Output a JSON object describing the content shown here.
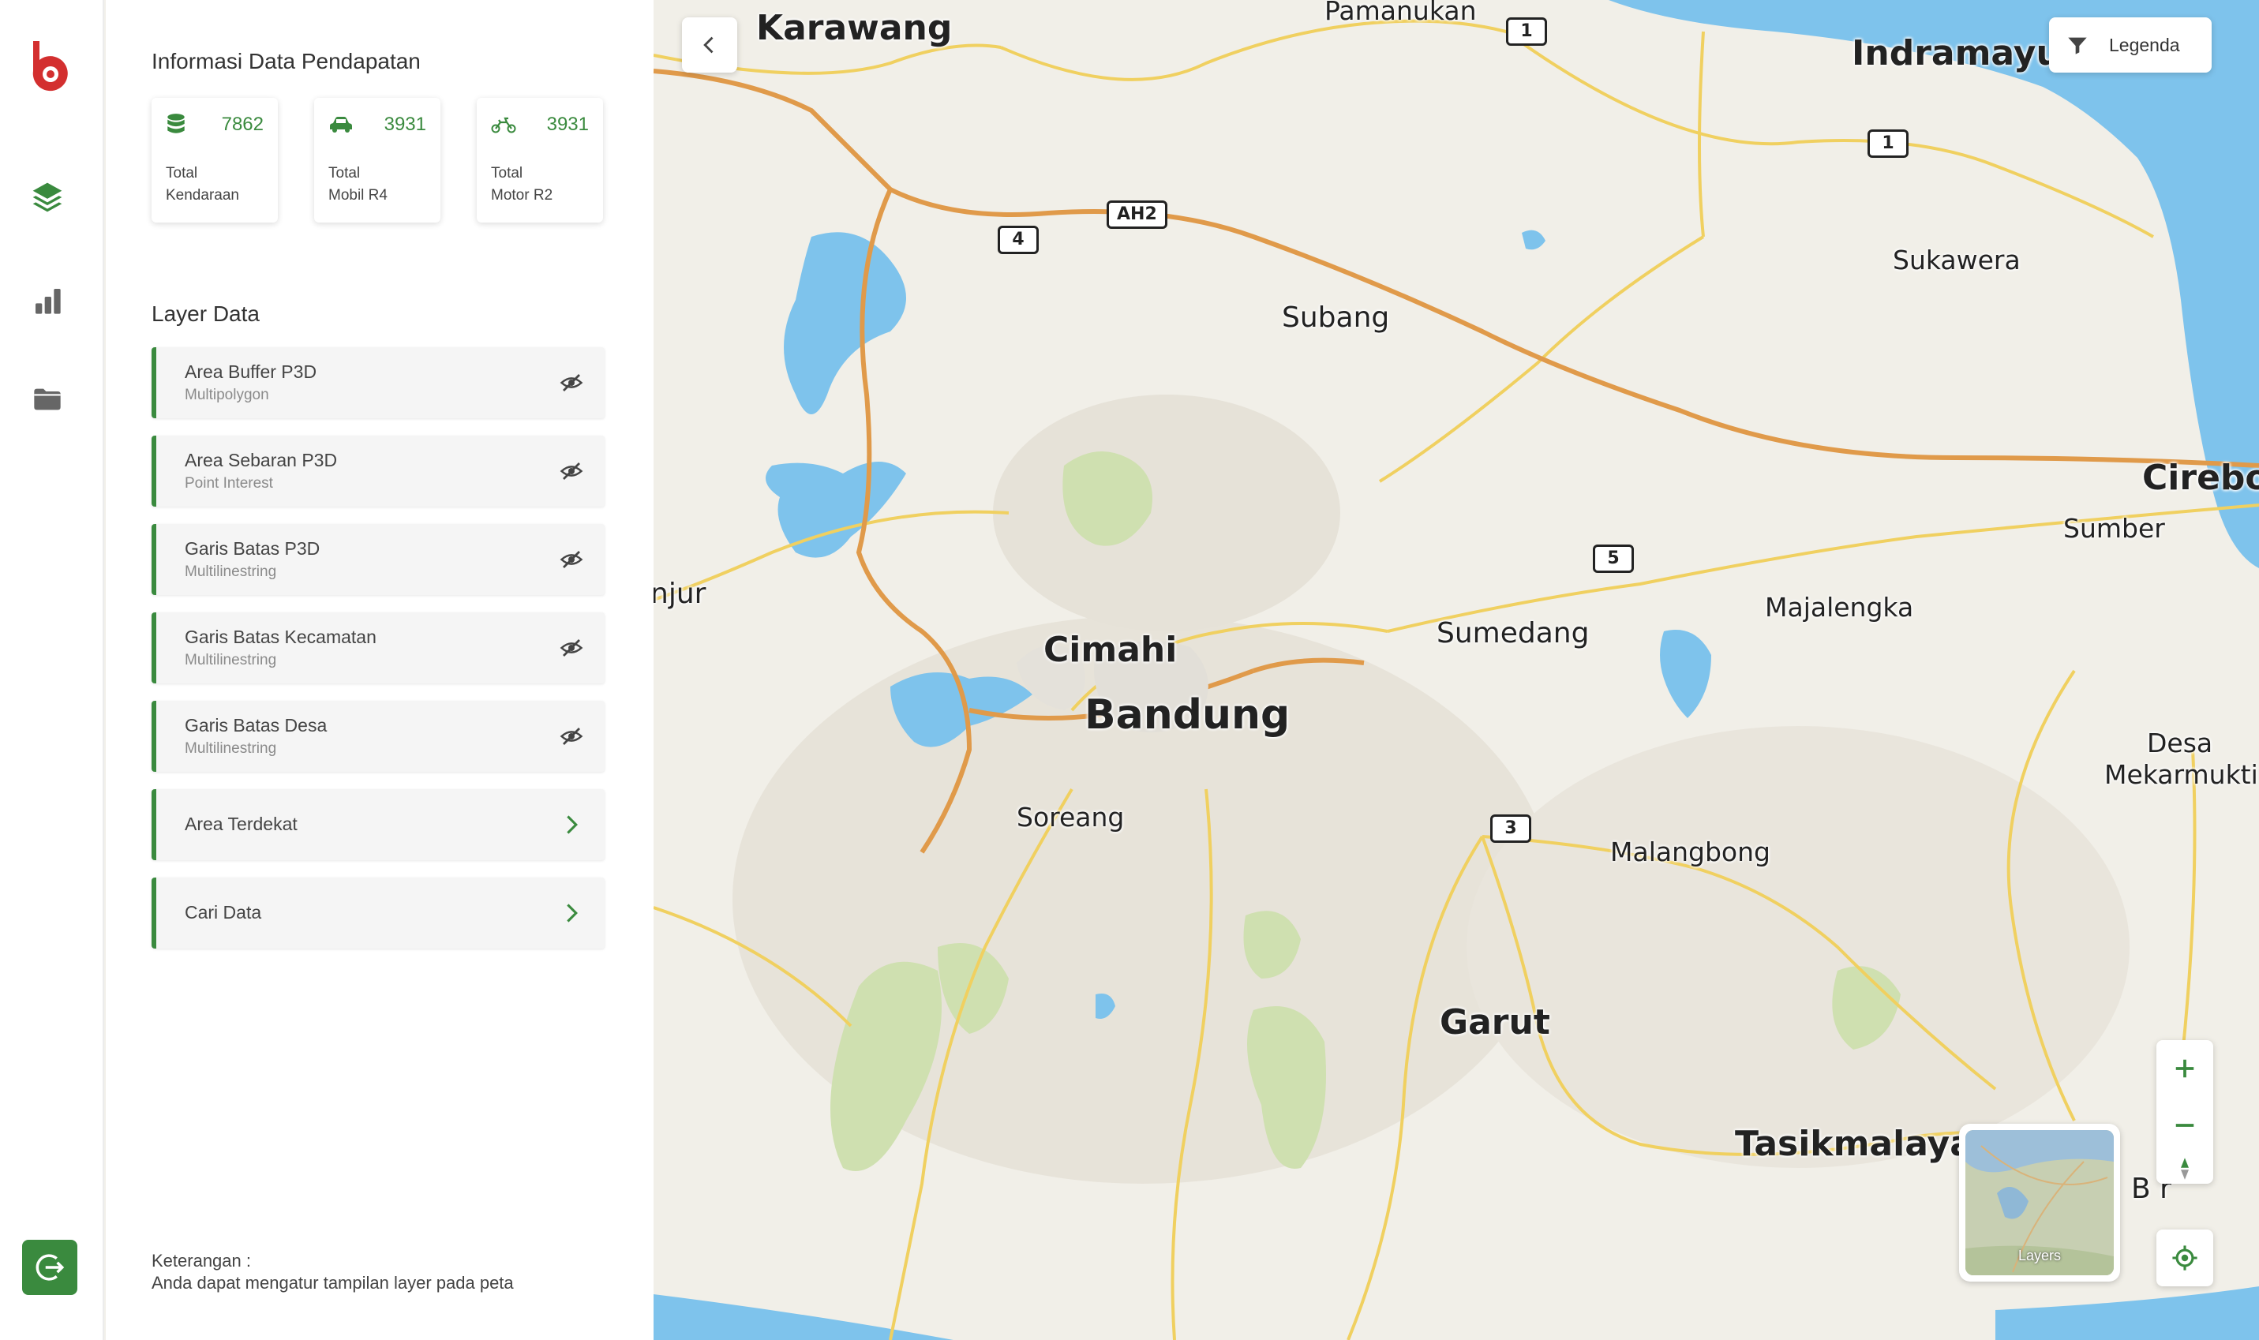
{
  "sidebar": {
    "nav": [
      {
        "icon": "layers-icon"
      },
      {
        "icon": "bar-chart-icon"
      },
      {
        "icon": "folder-icon"
      }
    ],
    "logout_icon": "logout-icon"
  },
  "info": {
    "title": "Informasi Data Pendapatan",
    "stats": [
      {
        "icon": "database-icon",
        "value": "7862",
        "label_line1": "Total",
        "label_line2": "Kendaraan"
      },
      {
        "icon": "car-icon",
        "value": "3931",
        "label_line1": "Total",
        "label_line2": "Mobil R4"
      },
      {
        "icon": "motorcycle-icon",
        "value": "3931",
        "label_line1": "Total",
        "label_line2": "Motor R2"
      }
    ]
  },
  "layers": {
    "title": "Layer Data",
    "items": [
      {
        "name": "Area Buffer P3D",
        "type": "Multipolygon",
        "action_icon": "eye-off-icon"
      },
      {
        "name": "Area Sebaran P3D",
        "type": "Point Interest",
        "action_icon": "eye-off-icon"
      },
      {
        "name": "Garis Batas P3D",
        "type": "Multilinestring",
        "action_icon": "eye-off-icon"
      },
      {
        "name": "Garis Batas Kecamatan",
        "type": "Multilinestring",
        "action_icon": "eye-off-icon"
      },
      {
        "name": "Garis Batas Desa",
        "type": "Multilinestring",
        "action_icon": "eye-off-icon"
      }
    ],
    "links": [
      {
        "name": "Area Terdekat",
        "action_icon": "chevron-right-icon"
      },
      {
        "name": "Cari Data",
        "action_icon": "chevron-right-icon"
      }
    ]
  },
  "note": {
    "label": "Keterangan :",
    "text": "Anda dapat mengatur tampilan layer pada peta"
  },
  "map": {
    "legend_label": "Legenda",
    "minimap_label": "Layers",
    "places": {
      "karawang": "Karawang",
      "pamanukan": "Pamanukan",
      "indramayu": "Indramayu",
      "sukawera": "Sukawera",
      "subang": "Subang",
      "cirebon": "Cirebon",
      "sumber": "Sumber",
      "njur": "njur",
      "majalengka": "Majalengka",
      "cimahi": "Cimahi",
      "sumedang": "Sumedang",
      "bandung": "Bandung",
      "desa": "Desa",
      "mekarmukti": "Mekarmukti",
      "soreang": "Soreang",
      "malangbong": "Malangbong",
      "garut": "Garut",
      "tasikmalaya": "Tasikmalaya",
      "banjar_partial": "B     r"
    },
    "shields": {
      "s1a": "1",
      "s1b": "1",
      "s4": "4",
      "ah2": "AH2",
      "s5": "5",
      "s3": "3"
    },
    "colors": {
      "water": "#7ec3ec",
      "land": "#f1efe8",
      "forest": "#cfe0b0",
      "primary_road": "#e09a4a",
      "secondary_road": "#f0d060",
      "accent": "#3a8a3e",
      "logo": "#d32f2f"
    }
  }
}
